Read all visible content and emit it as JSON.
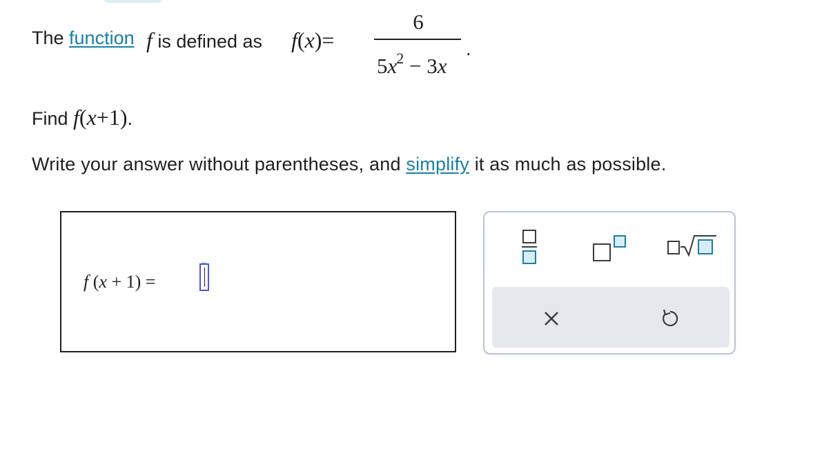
{
  "problem": {
    "intro_prefix": "The ",
    "function_link": "function",
    "intro_middle": " is defined as ",
    "fn_name": "f",
    "fn_arg": "(x)",
    "equals": "=",
    "numerator": "6",
    "denominator_coef1": "5x",
    "denominator_exp": "2",
    "denominator_rest": " − 3x",
    "period": ".",
    "find_prefix": "Find ",
    "find_expr_fn": "f",
    "find_expr_arg": "(x+1)",
    "find_period": ".",
    "instruction_prefix": "Write your answer without parentheses, and ",
    "simplify_link": "simplify",
    "instruction_suffix": " it as much as possible."
  },
  "answer": {
    "label_fn": "f",
    "label_rest": "(x + 1) =",
    "input_value": ""
  },
  "palette": {
    "buttons": [
      "fraction",
      "exponent",
      "nth-root"
    ],
    "actions": [
      "clear",
      "undo"
    ]
  },
  "colors": {
    "link": "#1a7fa3",
    "accent": "#1a7fa3",
    "input_border": "#4a56d6",
    "palette_border": "#b9c6d3",
    "action_row_bg": "#e4e8ed"
  },
  "icons": {
    "fraction": "fraction-icon",
    "exponent": "exponent-icon",
    "nth_root": "nth-root-icon",
    "clear": "close-icon",
    "undo": "undo-icon"
  }
}
